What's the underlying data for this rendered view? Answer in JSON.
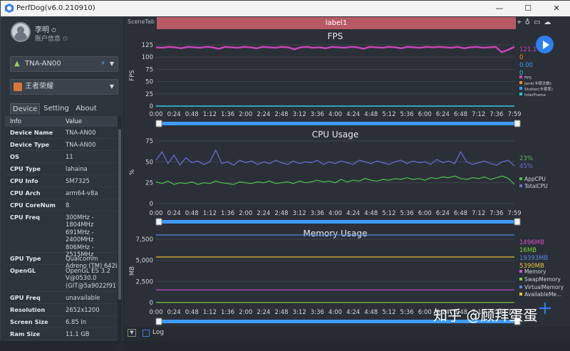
{
  "window": {
    "title": "PerfDog(v6.0.210910)",
    "controls": [
      "—",
      "☐",
      "✕"
    ]
  },
  "user": {
    "name": "李明",
    "account_label": "账户信息"
  },
  "device_select": {
    "value": "TNA-AN00"
  },
  "app_select": {
    "value": "王者荣耀"
  },
  "tabs": [
    "Device",
    "Setting",
    "About"
  ],
  "props": {
    "headers": [
      "Info",
      "Value"
    ],
    "rows": [
      {
        "k": "Device Name",
        "v": "TNA-AN00"
      },
      {
        "k": "Device Type",
        "v": "TNA-AN00"
      },
      {
        "k": "OS",
        "v": "11"
      },
      {
        "k": "CPU Type",
        "v": "lahaina"
      },
      {
        "k": "CPU Info",
        "v": "SM7325"
      },
      {
        "k": "CPU Arch",
        "v": "arm64-v8a"
      },
      {
        "k": "CPU CoreNum",
        "v": "8"
      },
      {
        "k": "CPU Freq",
        "v": "300MHz -\n1804MHz\n691MHz -\n2400MHz\n806MHz -\n2515MHz"
      },
      {
        "k": "GPU Type",
        "v": "Qualcomm\nAdreno (TM) 642L"
      },
      {
        "k": "OpenGL",
        "v": "OpenGL ES 3.2\nV@0530.0\n(GIT@5a9022f91f"
      },
      {
        "k": "GPU Freq",
        "v": "unavailable"
      },
      {
        "k": "Resolution",
        "v": "2652x1200"
      },
      {
        "k": "Screen Size",
        "v": "6.85 In"
      },
      {
        "k": "Ram Size",
        "v": "11.1 GB"
      }
    ]
  },
  "scene": {
    "tab_label": "SceneTab",
    "label": "label1"
  },
  "bottom": {
    "log_label": "Log"
  },
  "watermark": "知乎 @顾拜蛋蛋",
  "colors": {
    "fps": "#cc44bb",
    "jank": "#ff8a1f",
    "stutter": "#3d9bff",
    "interframe": "#26c6da",
    "appcpu": "#4fc24f",
    "totalcpu": "#6a6cd8",
    "memory": "#d94fc9",
    "swap": "#7fd13b",
    "virtual": "#4f86e0",
    "available": "#e8c23a",
    "slider": "#3d9bff"
  },
  "chart_data": [
    {
      "type": "line",
      "title": "FPS",
      "ylabel": "FPS",
      "ylim": [
        0,
        125
      ],
      "yticks": [
        0,
        25,
        50,
        75,
        100,
        125
      ],
      "xticks": [
        "0:00",
        "0:24",
        "0:48",
        "1:12",
        "1:36",
        "2:00",
        "2:24",
        "2:48",
        "3:12",
        "3:36",
        "4:00",
        "4:24",
        "4:48",
        "5:12",
        "5:36",
        "6:00",
        "6:24",
        "6:48",
        "7:12",
        "7:36",
        "7:59"
      ],
      "x_duration_s": 479,
      "series": [
        {
          "name": "FPS",
          "values": [
            120,
            119,
            121,
            120,
            118,
            121,
            120,
            119,
            121,
            120,
            117,
            121,
            120,
            119,
            121,
            120,
            118,
            121,
            120,
            119,
            121,
            120,
            116,
            120,
            121,
            119,
            120,
            118,
            121,
            120,
            119,
            121,
            120,
            117,
            121,
            120,
            119,
            121,
            120,
            118,
            121,
            120,
            119,
            121,
            120,
            121,
            120,
            119,
            121,
            118,
            120,
            121,
            119,
            120,
            121,
            110,
            115,
            121
          ]
        },
        {
          "name": "Jank(卡顿次数)",
          "values": [
            0,
            0
          ]
        },
        {
          "name": "Stutter(卡顿率)",
          "values": [
            0,
            0
          ]
        },
        {
          "name": "InterFrame",
          "values": [
            0,
            0
          ]
        }
      ],
      "current_values": [
        "121.1",
        "0",
        "0.00",
        "0"
      ]
    },
    {
      "type": "line",
      "title": "CPU Usage",
      "ylabel": "%",
      "ylim": [
        0,
        75
      ],
      "yticks": [
        0,
        25,
        50,
        75
      ],
      "xticks": [
        "0:00",
        "0:24",
        "0:48",
        "1:12",
        "1:36",
        "2:00",
        "2:24",
        "2:48",
        "3:12",
        "3:36",
        "4:00",
        "4:24",
        "4:48",
        "5:12",
        "5:36",
        "6:00",
        "6:24",
        "6:48",
        "7:12",
        "7:36",
        "7:59"
      ],
      "x_duration_s": 479,
      "series": [
        {
          "name": "AppCPU",
          "values": [
            26,
            24,
            27,
            23,
            25,
            24,
            26,
            23,
            25,
            24,
            27,
            25,
            24,
            23,
            26,
            25,
            24,
            26,
            25,
            27,
            24,
            25,
            26,
            24,
            27,
            25,
            26,
            28,
            26,
            27,
            25,
            29,
            26,
            28,
            27,
            30,
            28,
            27,
            29,
            28,
            30,
            29,
            31,
            29,
            30,
            28,
            31,
            30,
            32,
            31,
            33,
            30,
            29,
            31,
            30,
            32,
            29,
            31,
            33,
            30,
            23
          ]
        },
        {
          "name": "TotalCPU",
          "values": [
            52,
            62,
            48,
            58,
            46,
            55,
            49,
            51,
            47,
            50,
            64,
            48,
            50,
            46,
            52,
            49,
            51,
            47,
            50,
            48,
            52,
            49,
            47,
            51,
            48,
            50,
            49,
            52,
            47,
            50,
            48,
            51,
            49,
            47,
            52,
            50,
            48,
            51,
            49,
            47,
            50,
            52,
            48,
            51,
            49,
            50,
            47,
            53,
            49,
            51,
            48,
            62,
            50,
            47,
            49,
            51,
            48,
            46,
            50,
            52,
            45
          ]
        }
      ],
      "current_values": [
        "23%",
        "45%"
      ]
    },
    {
      "type": "line",
      "title": "Memory Usage",
      "ylabel": "MB",
      "ylim": [
        0,
        7500
      ],
      "yticks": [
        0,
        2500,
        5000,
        7500
      ],
      "ytick_labels": [
        "0",
        "2,500",
        "5,000",
        "7,500"
      ],
      "xticks": [
        "0:00",
        "0:24",
        "0:48",
        "1:12",
        "1:36",
        "2:00",
        "2:24",
        "2:48",
        "3:12",
        "3:36",
        "4:00",
        "4:24",
        "4:48",
        "5:12",
        "5:36",
        "6:00",
        "6:24",
        "6:48",
        "7:12",
        "7:36",
        "7:59"
      ],
      "x_duration_s": 479,
      "series": [
        {
          "name": "Memory",
          "values": [
            1496,
            1496
          ]
        },
        {
          "name": "SwapMemory",
          "values": [
            16,
            16
          ]
        },
        {
          "name": "VirtualMemory",
          "values": [
            19393,
            19393
          ]
        },
        {
          "name": "AvailableMemory",
          "values": [
            5390,
            5390
          ]
        }
      ],
      "legend_labels": [
        "Memory",
        "SwapMemory",
        "VirtualMemory",
        "AvailableMe..."
      ],
      "current_values": [
        "1496MB",
        "16MB",
        "19393MB",
        "5390MB"
      ]
    }
  ]
}
